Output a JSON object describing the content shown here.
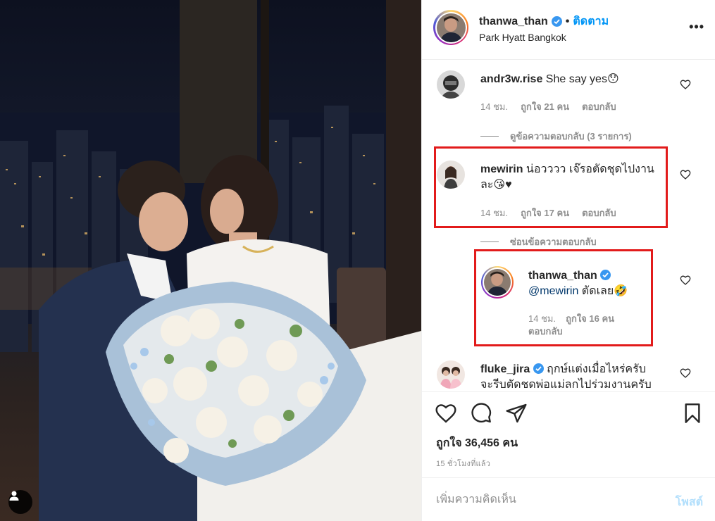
{
  "post": {
    "header": {
      "username": "thanwa_than",
      "separator": "•",
      "follow_label": "ติดตาม",
      "location": "Park Hyatt Bangkok",
      "more_label": "•••"
    },
    "comments": [
      {
        "username": "andr3w.rise",
        "text": "She say yes😯",
        "time": "14 ชม.",
        "likes": "ถูกใจ 21 คน",
        "reply_label": "ตอบกลับ",
        "view_replies": "ดูข้อความตอบกลับ (3 รายการ)"
      },
      {
        "username": "mewirin",
        "text_line1": "น่อวววว เจ๊รอตัดชุดไปงาน",
        "text_line2": "ละ😘♥",
        "time": "14 ชม.",
        "likes": "ถูกใจ 17 คน",
        "reply_label": "ตอบกลับ",
        "hide_replies": "ซ่อนข้อความตอบกลับ"
      },
      {
        "username": "thanwa_than",
        "mention": "@mewirin",
        "text": " ตัดเลย🤣",
        "time": "14 ชม.",
        "likes": "ถูกใจ 16 คน",
        "reply_label": "ตอบกลับ"
      },
      {
        "username": "fluke_jira",
        "text_line1": "ฤกษ์แต่งเมื่อไหร่ครับ",
        "text_line2": "จะรีบตัดชดพ่อแม่ลกไปร่วมงานครับ"
      }
    ],
    "likes_count": "ถูกใจ 36,456 คน",
    "time_ago": "15 ชั่วโมงที่แล้ว",
    "comment_placeholder": "เพิ่มความคิดเห็น",
    "post_button": "โพสต์"
  },
  "colors": {
    "accent": "#0095f6",
    "highlight": "#e21b1b",
    "muted": "#8e8e8e",
    "post_disabled": "#b2dffc"
  },
  "icons": [
    "heart-icon",
    "comment-icon",
    "share-icon",
    "bookmark-icon",
    "verified-icon",
    "user-tag-icon"
  ]
}
